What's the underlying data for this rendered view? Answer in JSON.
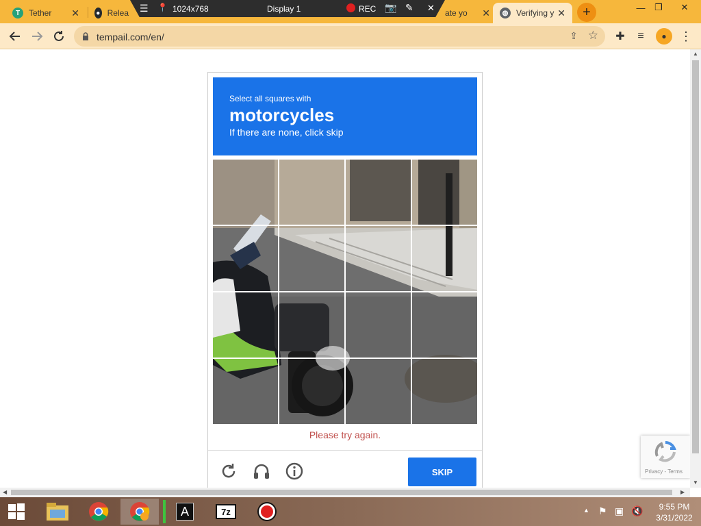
{
  "browser": {
    "tabs": [
      {
        "title": "Tether",
        "active": false
      },
      {
        "title": "Relea",
        "active": false
      },
      {
        "title": "ate yo",
        "active": false
      },
      {
        "title": "Verifying y",
        "active": true
      }
    ],
    "url": "tempail.com/en/"
  },
  "recorder": {
    "resolution": "1024x768",
    "display": "Display 1",
    "rec_label": "REC"
  },
  "captcha": {
    "instruction_small": "Select all squares with",
    "target": "motorcycles",
    "instruction_sub": "If there are none, click skip",
    "error_message": "Please try again.",
    "skip_label": "SKIP",
    "grid": {
      "rows": 4,
      "cols": 4
    },
    "footer_icons": [
      "reload-icon",
      "audio-icon",
      "info-icon"
    ]
  },
  "recaptcha_badge": {
    "links": "Privacy - Terms"
  },
  "taskbar": {
    "apps": [
      "start-icon",
      "file-explorer-icon",
      "chrome-icon",
      "chrome-profile-icon",
      "notepad-a-icon",
      "7zip-icon",
      "recorder-icon"
    ],
    "clock_time": "9:55 PM",
    "clock_date": "3/31/2022"
  },
  "colors": {
    "tab_strip": "#f6b73c",
    "toolbar": "#fde9c7",
    "captcha_blue": "#1a73e8",
    "error_red": "#c0504d"
  }
}
